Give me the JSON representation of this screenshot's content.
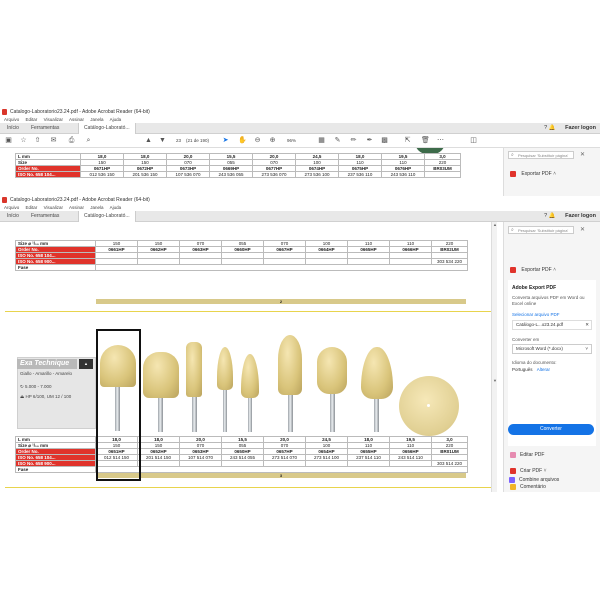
{
  "back_window": {
    "title": "Catalogo-Laboratorio23.24.pdf - Adobe Acrobat Reader (64-bit)",
    "menus": [
      "Arquivo",
      "Editar",
      "Visualizar",
      "Assinar",
      "Janela",
      "Ajuda"
    ],
    "tabs": [
      "Início",
      "Ferramentas",
      "Catálogo-Laborató..."
    ],
    "login": "Fazer logon",
    "page_number": "23",
    "page_total": "(21 de 190)",
    "zoom": "96%",
    "search_placeholder": "Pesquisar 'Substituir página'",
    "export_label": "Exportar PDF"
  },
  "front_window": {
    "title": "Catalogo-Laboratorio23.24.pdf - Adobe Acrobat Reader (64-bit)",
    "menus": [
      "Arquivo",
      "Editar",
      "Visualizar",
      "Assinar",
      "Janela",
      "Ajuda"
    ],
    "tabs": [
      "Início",
      "Ferramentas",
      "Catálogo-Laborató..."
    ],
    "login": "Fazer logon",
    "search_placeholder": "Pesquisar 'Substituir página'",
    "export_label": "Exportar PDF"
  },
  "back_table": {
    "header": [
      "L mm",
      "18,0",
      "18,0",
      "20,0",
      "15,5",
      "20,0",
      "24,5",
      "18,0",
      "19,5",
      "3,0"
    ],
    "order_label": "Order No.",
    "order": [
      "0671HP",
      "0672HP",
      "0673HP",
      "0669HP",
      "0677HP",
      "0674HP",
      "0675HP",
      "0676HP",
      "BR03UM"
    ],
    "iso_label": "ISO No. 658 104...",
    "iso": [
      "012 536 150",
      "201 536 150",
      "107 536 070",
      "243 536 055",
      "273 536 070",
      "273 536 100",
      "237 536 110",
      "243 536 110",
      ""
    ],
    "size_row": [
      "150",
      "150",
      "070",
      "055",
      "070",
      "100",
      "110",
      "110",
      "220"
    ]
  },
  "top_table": {
    "size_label": "Size ⌀ ¹/₁₀ mm",
    "size_row": [
      "150",
      "150",
      "070",
      "055",
      "070",
      "100",
      "110",
      "110",
      "220"
    ],
    "order_label": "Order No.",
    "order": [
      "0661HP",
      "0662HP",
      "0663HP",
      "0660HP",
      "0667HP",
      "0664HP",
      "0665HP",
      "0666HP",
      "BR02UM"
    ],
    "iso1_label": "ISO No. 658 104...",
    "iso2_label": "ISO No. 658 900...",
    "iso2": [
      "",
      "",
      "",
      "",
      "",
      "",
      "",
      "",
      "303 534 220"
    ],
    "fase_label": "Fase",
    "section_number": "2"
  },
  "product": {
    "name": "Exa Technique",
    "subtitle": "Giallo - Amarillo - Amarelo",
    "rpm": "5.000 - 7.000",
    "shank": "HP 6/100, UM 12 / 100"
  },
  "bottom_table": {
    "length_label": "L mm",
    "length": [
      "18,0",
      "18,0",
      "20,0",
      "15,5",
      "20,0",
      "24,5",
      "18,0",
      "19,5",
      "3,0"
    ],
    "size_label": "Size ⌀ ¹/₁₀ mm",
    "size": [
      "150",
      "150",
      "070",
      "055",
      "070",
      "100",
      "110",
      "110",
      "220"
    ],
    "order_label": "Order No.",
    "order": [
      "0651HP",
      "0652HP",
      "0653HP",
      "0650HP",
      "0657HP",
      "0654HP",
      "0655HP",
      "0656HP",
      "BR01UM"
    ],
    "iso1_label": "ISO No. 658 104...",
    "iso1": [
      "012 514 150",
      "201 514 150",
      "107 514 070",
      "243 514 055",
      "273 514 070",
      "273 514 100",
      "237 514 110",
      "243 514 110",
      ""
    ],
    "iso2_label": "ISO No. 658 900...",
    "iso2": [
      "",
      "",
      "",
      "",
      "",
      "",
      "",
      "",
      "303 514 220"
    ],
    "fase_label": "Fase",
    "section_number": "3"
  },
  "export_panel": {
    "title": "Adobe Export PDF",
    "description": "Converta arquivos PDF em Word ou Excel online",
    "select_label": "Selecionar arquivo PDF",
    "file_name": "Catálogo-L...o23.24.pdf",
    "convert_to_label": "Converter em",
    "convert_to_value": "Microsoft Word (*.docx)",
    "language_label": "Idioma do documento:",
    "language_value": "Português",
    "change_link": "Alterar",
    "convert_button": "Converter"
  },
  "tools_list": [
    "Editar PDF",
    "Criar PDF",
    "Comentário",
    "Combine arquivos"
  ],
  "colors": {
    "accent": "#1473e6",
    "order_red": "#e0332b",
    "stone_yellow": "#d9c47a",
    "section_bar": "#d8c98a"
  }
}
